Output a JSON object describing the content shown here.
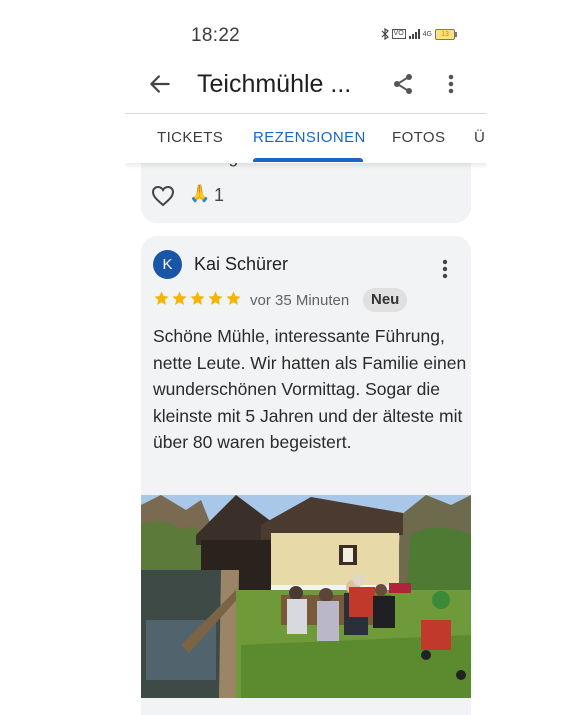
{
  "status_bar": {
    "time": "18:22",
    "network": "4G",
    "battery": "13"
  },
  "app_bar": {
    "title": "Teichmühle ...",
    "back_icon": "arrow-left-icon",
    "share_icon": "share-icon",
    "more_icon": "more-vert-icon"
  },
  "tabs": [
    {
      "label": "TICKETS"
    },
    {
      "label": "REZENSIONEN",
      "active": true
    },
    {
      "label": "FOTOS"
    },
    {
      "label": "Ü"
    }
  ],
  "previous_review": {
    "partial_text": "Leider oft geschlossen.",
    "reaction_emoji": "🙏",
    "reaction_count": "1"
  },
  "review": {
    "avatar_letter": "K",
    "author": "Kai Schürer",
    "rating": 5,
    "time": "vor 35 Minuten",
    "badge": "Neu",
    "text": "Schöne Mühle, interessante Führung, nette Leute. Wir hatten als Familie einen wunderschönen Vormittag. Sogar die kleinste mit 5 Jahren und der älteste mit über 80 waren begeistert."
  },
  "colors": {
    "accent": "#1a66c8",
    "star": "#f4b400",
    "avatar": "#1a56a8",
    "card": "#f1f3f4"
  }
}
